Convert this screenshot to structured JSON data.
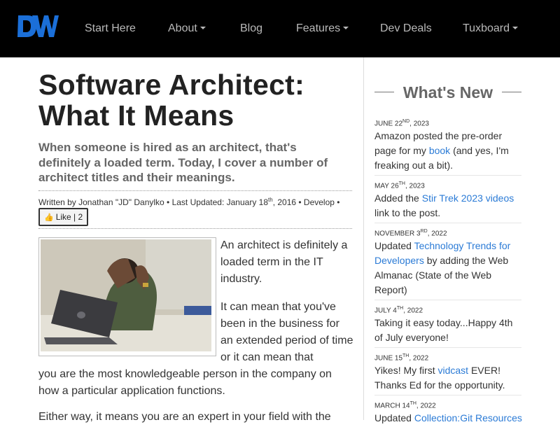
{
  "nav": {
    "items": [
      {
        "label": "Start Here",
        "dropdown": false
      },
      {
        "label": "About",
        "dropdown": true
      },
      {
        "label": "Blog",
        "dropdown": false
      },
      {
        "label": "Features",
        "dropdown": true
      },
      {
        "label": "Dev Deals",
        "dropdown": false
      },
      {
        "label": "Tuxboard",
        "dropdown": true
      }
    ]
  },
  "article": {
    "title": "Software Architect: What It Means",
    "subtitle": "When someone is hired as an architect, that's definitely a loaded term. Today, I cover a number of architect titles and their meanings.",
    "byline": {
      "prefix": "Written by Jonathan \"JD\" Danylko • Last Updated: January 18",
      "sup": "th",
      "suffix": ", 2016 • Develop •"
    },
    "like_label": "Like | 2",
    "paragraphs": [
      "An architect is definitely a loaded term in the IT industry.",
      "It can mean that you've been in the business for an extended period of time or it can mean that",
      "you are the most knowledgeable person in the company on how a particular application functions.",
      "Either way, it means you are an expert in your field with the"
    ]
  },
  "sidebar": {
    "heading": "What's New",
    "items": [
      {
        "date": "JUNE 22",
        "sup": "ND",
        "year": ", 2023",
        "before": "Amazon posted the pre-order page for my ",
        "link": "book",
        "after": " (and yes, I'm freaking out a bit)."
      },
      {
        "date": "MAY 26",
        "sup": "TH",
        "year": ", 2023",
        "before": "Added the ",
        "link": "Stir Trek 2023 videos",
        "after": " link to the post."
      },
      {
        "date": "NOVEMBER 3",
        "sup": "RD",
        "year": ", 2022",
        "before": "Updated ",
        "link": "Technology Trends for Developers",
        "after": " by adding the Web Almanac (State of the Web Report)"
      },
      {
        "date": "JULY 4",
        "sup": "TH",
        "year": ", 2022",
        "before": "Taking it easy today...Happy 4th of July everyone!",
        "link": "",
        "after": ""
      },
      {
        "date": "JUNE 15",
        "sup": "TH",
        "year": ", 2022",
        "before": "Yikes! My first ",
        "link": "vidcast",
        "after": " EVER! Thanks Ed for the opportunity."
      },
      {
        "date": "MARCH 14",
        "sup": "TH",
        "year": ", 2022",
        "before": "Updated ",
        "link": "Collection:Git Resources",
        "after": ""
      }
    ]
  },
  "colors": {
    "nav_bg": "#000000",
    "link": "#2b7bd6",
    "logo": "#1b6fd8"
  }
}
